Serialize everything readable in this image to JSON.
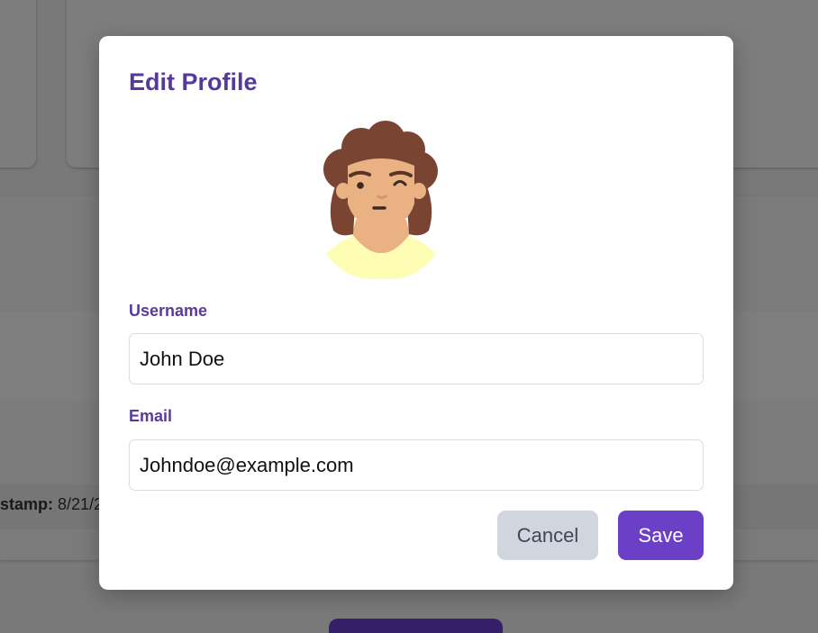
{
  "background": {
    "stamp_label": "stamp:",
    "stamp_value": "8/21/2"
  },
  "modal": {
    "title": "Edit Profile",
    "avatar_icon": "woman-curly-hair-avatar",
    "username": {
      "label": "Username",
      "value": "John Doe"
    },
    "email": {
      "label": "Email",
      "value": "Johndoe@example.com"
    },
    "cancel_label": "Cancel",
    "save_label": "Save"
  },
  "colors": {
    "accent": "#6b3fc6",
    "title": "#553a9b",
    "cancel_bg": "#d1d5de"
  }
}
